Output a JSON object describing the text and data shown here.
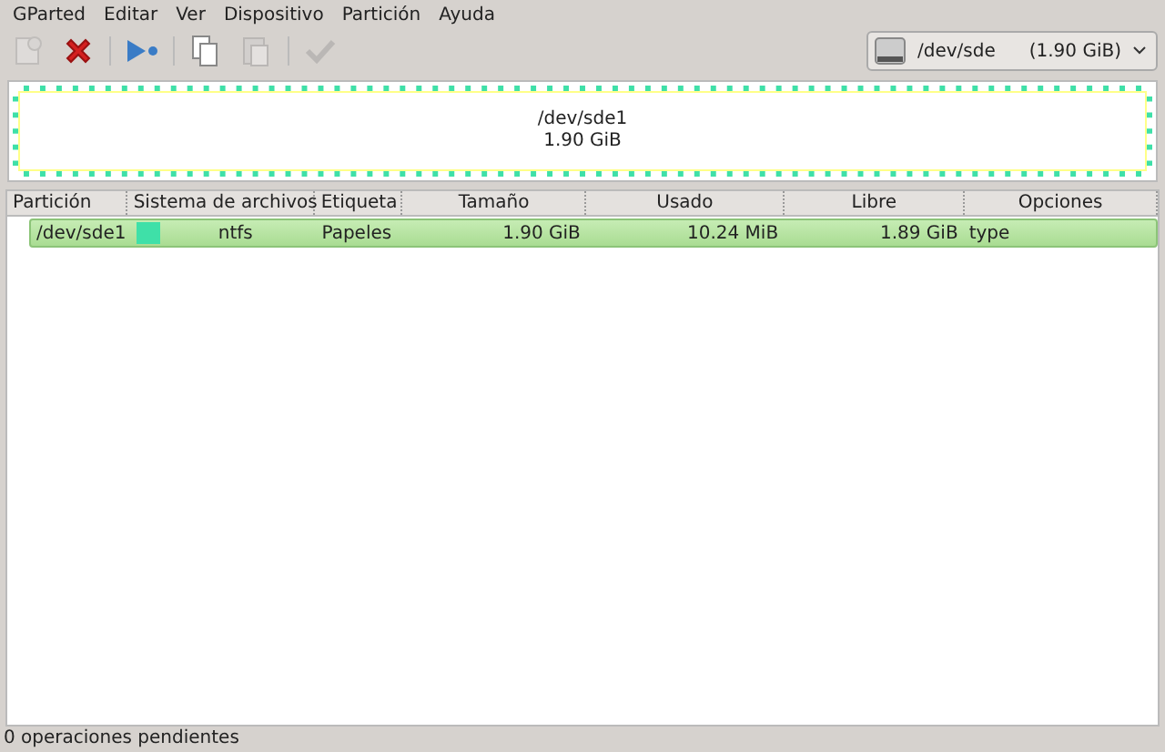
{
  "menu": [
    "GParted",
    "Editar",
    "Ver",
    "Dispositivo",
    "Partición",
    "Ayuda"
  ],
  "toolbar": [
    {
      "kind": "new",
      "disabled": true
    },
    {
      "kind": "delete",
      "disabled": false
    },
    {
      "kind": "sep"
    },
    {
      "kind": "apply-arrow",
      "disabled": false
    },
    {
      "kind": "sep"
    },
    {
      "kind": "copy",
      "disabled": false
    },
    {
      "kind": "paste",
      "disabled": true
    },
    {
      "kind": "sep"
    },
    {
      "kind": "check",
      "disabled": true
    }
  ],
  "device": {
    "name": "/dev/sde",
    "size": "(1.90 GiB)"
  },
  "disk_map": {
    "partitions": [
      {
        "name": "/dev/sde1",
        "size": "1.90 GiB",
        "color": "#3fe0a8",
        "selected": true
      }
    ]
  },
  "table": {
    "columns": [
      "Partición",
      "Sistema de archivos",
      "Etiqueta",
      "Tamaño",
      "Usado",
      "Libre",
      "Opciones"
    ],
    "rows": [
      {
        "partition": "/dev/sde1",
        "color": "#3fe0a8",
        "filesystem": "ntfs",
        "label": "Papeles",
        "size": "1.90 GiB",
        "used": "10.24 MiB",
        "free": "1.89 GiB",
        "options": "type",
        "selected": true
      }
    ]
  },
  "status_bar": "0 operaciones pendientes"
}
